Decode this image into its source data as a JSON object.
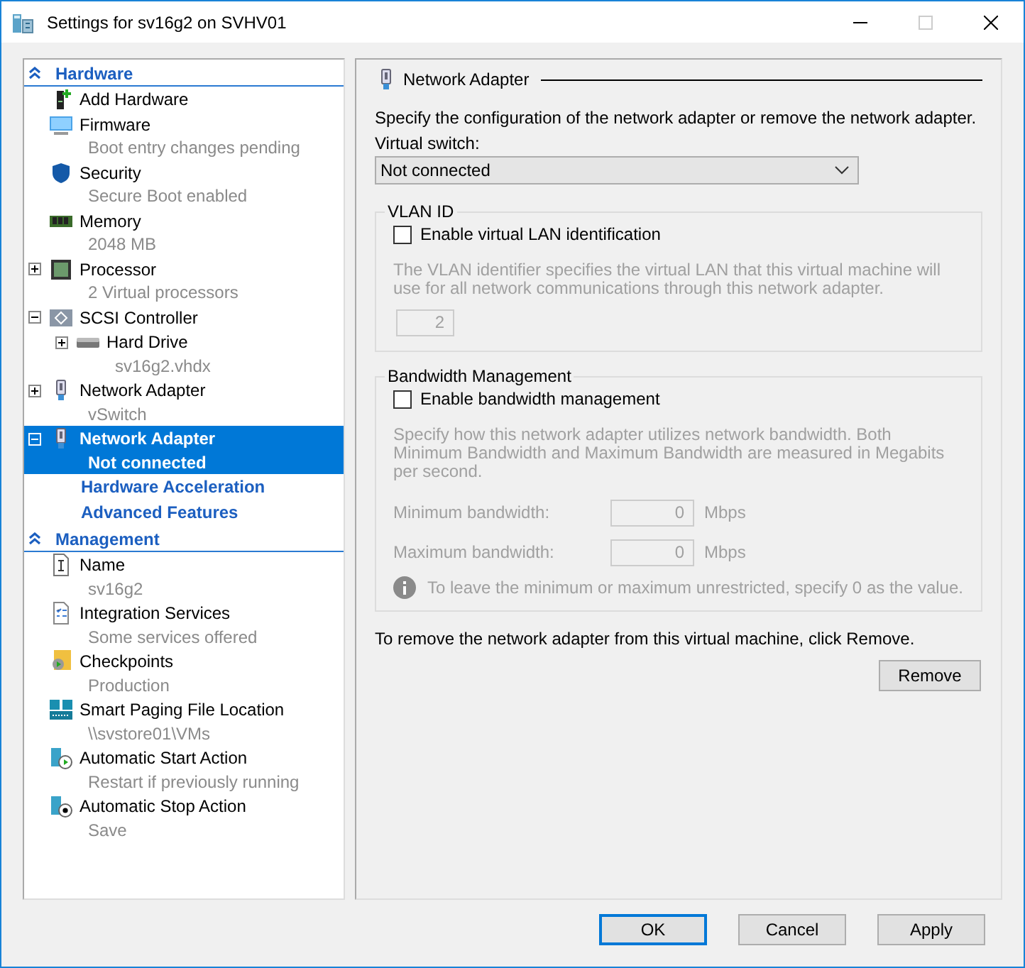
{
  "window": {
    "title": "Settings for sv16g2 on SVHV01"
  },
  "tree": {
    "sections": [
      {
        "label": "Hardware",
        "expanded": true,
        "items": [
          {
            "kind": "add",
            "label": "Add Hardware",
            "selected": false
          },
          {
            "kind": "firmware",
            "label": "Firmware",
            "detail": "Boot entry changes pending",
            "selected": false
          },
          {
            "kind": "security",
            "label": "Security",
            "detail": "Secure Boot enabled",
            "selected": false
          },
          {
            "kind": "memory",
            "label": "Memory",
            "detail": "2048 MB",
            "selected": false
          },
          {
            "kind": "processor",
            "label": "Processor",
            "detail": "2 Virtual processors",
            "selected": false,
            "expanded": false
          },
          {
            "kind": "controller",
            "label": "SCSI Controller",
            "selected": false,
            "expanded": true,
            "children": [
              {
                "kind": "drive",
                "label": "Hard Drive",
                "detail": "sv16g2.vhdx",
                "selected": false,
                "expanded": false
              }
            ]
          },
          {
            "kind": "network",
            "label": "Network Adapter",
            "detail": "vSwitch",
            "selected": false,
            "expanded": false
          },
          {
            "kind": "network",
            "label": "Network Adapter",
            "detail": "Not connected",
            "selected": true,
            "expanded": true,
            "children": [
              {
                "kind": "link",
                "label": "Hardware Acceleration",
                "selected": false
              },
              {
                "kind": "link",
                "label": "Advanced Features",
                "selected": false
              }
            ]
          }
        ]
      },
      {
        "label": "Management",
        "expanded": true,
        "items": [
          {
            "kind": "name",
            "label": "Name",
            "detail": "sv16g2",
            "selected": false
          },
          {
            "kind": "services",
            "label": "Integration Services",
            "detail": "Some services offered",
            "selected": false
          },
          {
            "kind": "checkpoints",
            "label": "Checkpoints",
            "detail": "Production",
            "selected": false
          },
          {
            "kind": "paging",
            "label": "Smart Paging File Location",
            "detail": "\\\\svstore01\\VMs",
            "selected": false
          },
          {
            "kind": "start",
            "label": "Automatic Start Action",
            "detail": "Restart if previously running",
            "selected": false
          },
          {
            "kind": "stop",
            "label": "Automatic Stop Action",
            "detail": "Save",
            "selected": false
          }
        ]
      }
    ]
  },
  "panel": {
    "title": "Network Adapter",
    "intro": "Specify the configuration of the network adapter or remove the network adapter.",
    "switch_label": "Virtual switch:",
    "switch_value": "Not connected",
    "vlan": {
      "legend": "VLAN ID",
      "checkbox": {
        "label": "Enable virtual LAN identification",
        "checked": false
      },
      "description": "The VLAN identifier specifies the virtual LAN that this virtual machine will use for all network communications through this network adapter.",
      "id_value": "2"
    },
    "bandwidth": {
      "legend": "Bandwidth Management",
      "checkbox": {
        "label": "Enable bandwidth management",
        "checked": false
      },
      "description": "Specify how this network adapter utilizes network bandwidth. Both Minimum Bandwidth and Maximum Bandwidth are measured in Megabits per second.",
      "fields": [
        {
          "label": "Minimum bandwidth:",
          "value": "0",
          "unit": "Mbps"
        },
        {
          "label": "Maximum bandwidth:",
          "value": "0",
          "unit": "Mbps"
        }
      ],
      "note": "To leave the minimum or maximum unrestricted, specify 0 as the value."
    },
    "remove_text": "To remove the network adapter from this virtual machine, click Remove.",
    "remove_button": "Remove"
  },
  "buttons": [
    {
      "label": "OK",
      "default": true
    },
    {
      "label": "Cancel",
      "default": false
    },
    {
      "label": "Apply",
      "default": false
    }
  ]
}
